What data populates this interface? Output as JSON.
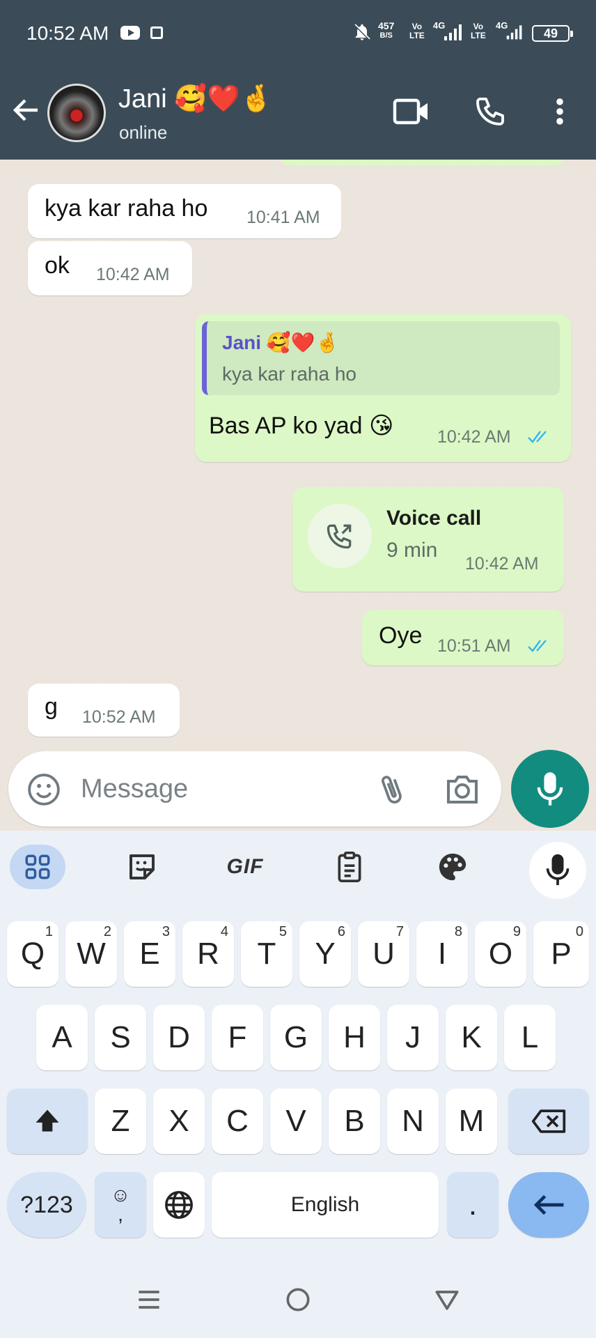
{
  "status_bar": {
    "time": "10:52 AM",
    "net_speed_value": "457",
    "net_speed_unit": "B/S",
    "sim1_volte": "Vo\nLTE",
    "sim1_network": "4G",
    "sim2_volte": "Vo\nLTE",
    "sim2_network": "4G",
    "battery": "49"
  },
  "header": {
    "contact_name": "Jani 🥰❤️🤞",
    "contact_status": "online"
  },
  "messages": [
    {
      "direction": "incoming",
      "text": "kya kar raha ho",
      "time": "10:41 AM"
    },
    {
      "direction": "incoming",
      "text": "ok",
      "time": "10:42 AM"
    },
    {
      "direction": "outgoing",
      "reply_to_name": "Jani 🥰❤️🤞",
      "reply_to_text": "kya kar raha ho",
      "text": "Bas AP ko yad 😘",
      "time": "10:42 AM",
      "read": true
    },
    {
      "direction": "outgoing",
      "type": "call",
      "title": "Voice call",
      "duration": "9 min",
      "time": "10:42 AM"
    },
    {
      "direction": "outgoing",
      "text": "Oye",
      "time": "10:51 AM",
      "read": true
    },
    {
      "direction": "incoming",
      "text": "g",
      "time": "10:52 AM"
    }
  ],
  "input": {
    "placeholder": "Message"
  },
  "keyboard": {
    "toolbar": {
      "gif_label": "GIF"
    },
    "row1": [
      {
        "key": "Q",
        "hint": "1"
      },
      {
        "key": "W",
        "hint": "2"
      },
      {
        "key": "E",
        "hint": "3"
      },
      {
        "key": "R",
        "hint": "4"
      },
      {
        "key": "T",
        "hint": "5"
      },
      {
        "key": "Y",
        "hint": "6"
      },
      {
        "key": "U",
        "hint": "7"
      },
      {
        "key": "I",
        "hint": "8"
      },
      {
        "key": "O",
        "hint": "9"
      },
      {
        "key": "P",
        "hint": "0"
      }
    ],
    "row2": [
      "A",
      "S",
      "D",
      "F",
      "G",
      "H",
      "J",
      "K",
      "L"
    ],
    "row3": [
      "Z",
      "X",
      "C",
      "V",
      "B",
      "N",
      "M"
    ],
    "symbols_label": "?123",
    "emoji_comma_top": "☺",
    "emoji_comma_bottom": ",",
    "space_label": "English",
    "period_label": "."
  },
  "icons": {
    "back": "back-arrow-icon",
    "video": "video-call-icon",
    "call": "phone-icon",
    "more": "more-vert-icon",
    "emoji": "emoji-icon",
    "attach": "paperclip-icon",
    "camera": "camera-icon",
    "mic": "mic-icon"
  },
  "colors": {
    "header": "#3b4c58",
    "outgoing_bubble": "#dcf8c6",
    "incoming_bubble": "#ffffff",
    "accent_green": "#128c7e",
    "read_ticks": "#34b7f1",
    "reply_accent": "#6b62d8"
  }
}
